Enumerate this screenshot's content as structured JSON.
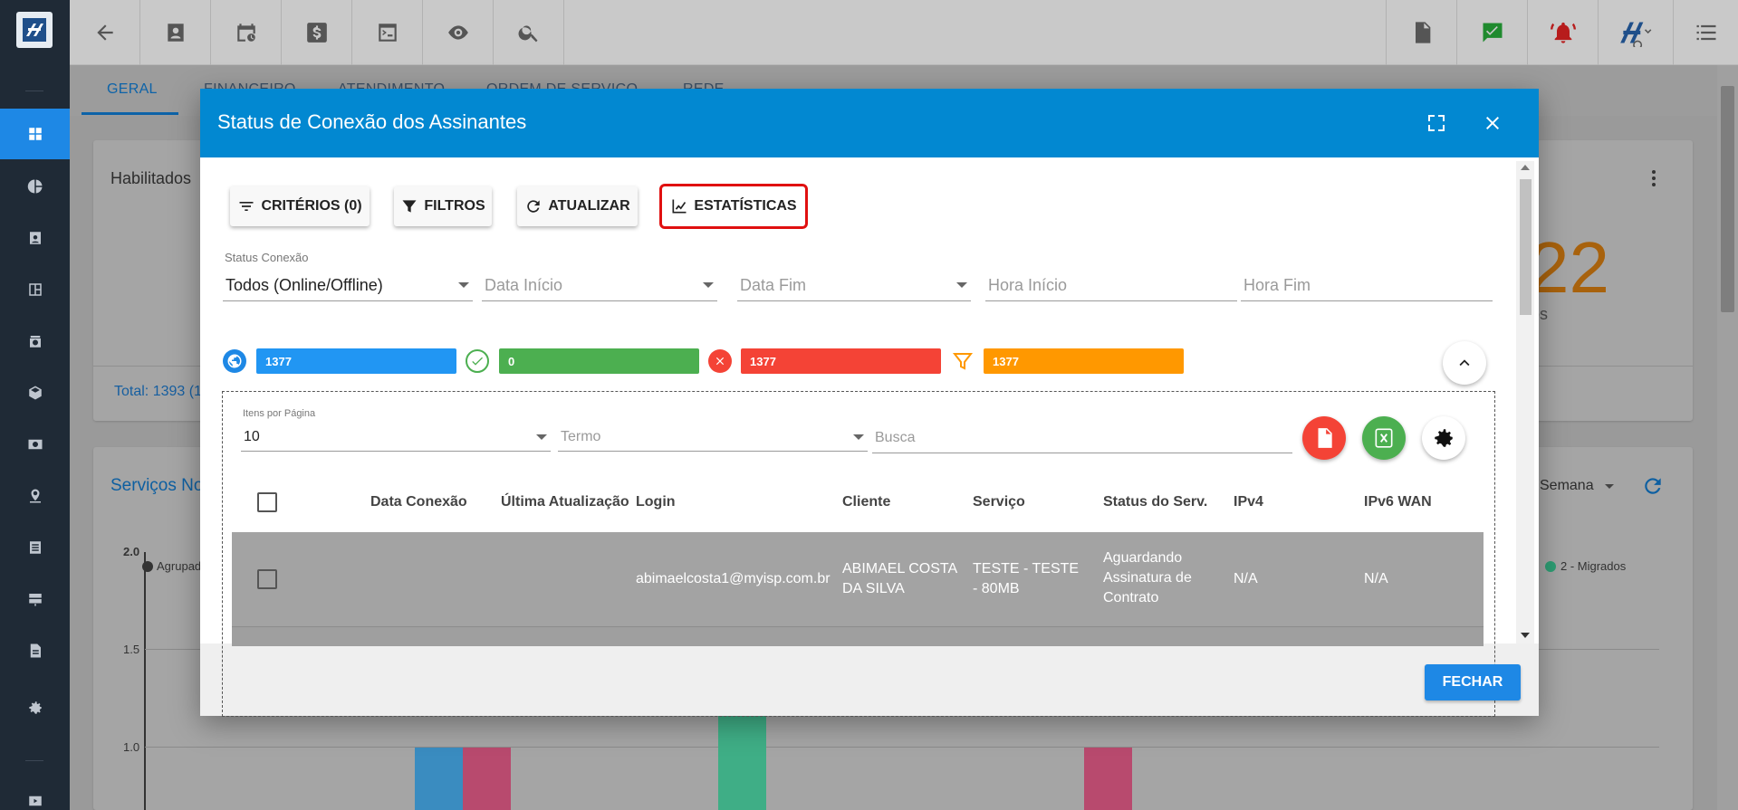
{
  "sidebar": {
    "items": [
      "dashboard-icon",
      "chart-pie-icon",
      "contact-icon",
      "layout-icon",
      "calendar-clock-icon",
      "package-icon",
      "money-icon",
      "map-marker-icon",
      "list-icon",
      "server-icon",
      "document-icon",
      "gear-icon",
      "video-icon"
    ]
  },
  "background": {
    "tabs": [
      "GERAL",
      "FINANCEIRO",
      "ATENDIMENTO",
      "ORDEM DE SERVIÇO",
      "REDE"
    ],
    "habilitados": "Habilitados",
    "big_number_fragment": "22",
    "big_number_suffix": "os",
    "total": "Total: 1393 (1",
    "servicos": "Serviços No",
    "semana": "Semana",
    "legend_agrupado": "Agrupad",
    "legend_migrados": "2 - Migrados",
    "y_ticks": [
      "2.0",
      "1.5",
      "1.0"
    ]
  },
  "modal": {
    "title": "Status de Conexão dos Assinantes",
    "buttons": {
      "criterios": "CRITÉRIOS (0)",
      "filtros": "FILTROS",
      "atualizar": "ATUALIZAR",
      "estatisticas": "ESTATÍSTICAS"
    },
    "status_label": "Status Conexão",
    "status_value": "Todos (Online/Offline)",
    "data_inicio": "Data Início",
    "data_fim": "Data Fim",
    "hora_inicio": "Hora Início",
    "hora_fim": "Hora Fim",
    "stats": {
      "total": "1377",
      "online": "0",
      "offline": "1377",
      "filtered": "1377",
      "colors": {
        "total": "#2196f3",
        "online": "#4caf50",
        "offline": "#f44336",
        "filtered": "#ff9800"
      }
    },
    "itens_label": "Itens por Página",
    "itens_value": "10",
    "termo": "Termo",
    "busca": "Busca",
    "table": {
      "headers": [
        "Data Conexão",
        "Última Atualização",
        "Login",
        "Cliente",
        "Serviço",
        "Status do Serv.",
        "IPv4",
        "IPv6 WAN"
      ],
      "rows": [
        {
          "login": "abimaelcosta1@myisp.com.br",
          "cliente": "ABIMAEL COSTA DA SILVA",
          "servico": "TESTE - TESTE - 80MB",
          "status": "Aguardando Assinatura de Contrato",
          "ipv4": "N/A",
          "ipv6": "N/A"
        }
      ]
    },
    "fechar": "FECHAR"
  }
}
